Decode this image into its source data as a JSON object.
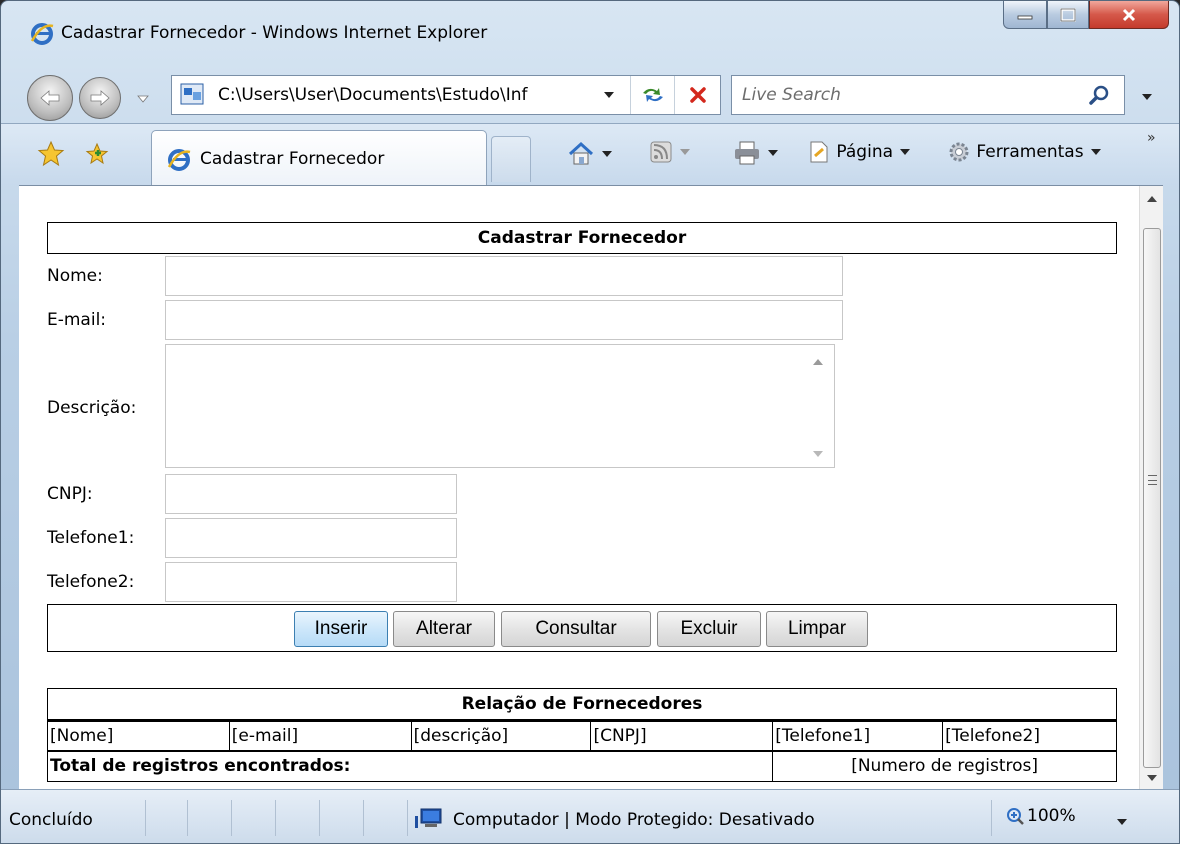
{
  "window": {
    "title": "Cadastrar Fornecedor - Windows Internet Explorer"
  },
  "address_bar": {
    "url": "C:\\Users\\User\\Documents\\Estudo\\Inf"
  },
  "search": {
    "placeholder": "Live Search"
  },
  "tab": {
    "label": "Cadastrar Fornecedor"
  },
  "command_bar": {
    "page_label": "Página",
    "tools_label": "Ferramentas"
  },
  "form": {
    "title": "Cadastrar Fornecedor",
    "labels": {
      "nome": "Nome:",
      "email": "E-mail:",
      "descricao": "Descrição:",
      "cnpj": "CNPJ:",
      "telefone1": "Telefone1:",
      "telefone2": "Telefone2:"
    },
    "values": {
      "nome": "",
      "email": "",
      "descricao": "",
      "cnpj": "",
      "telefone1": "",
      "telefone2": ""
    },
    "buttons": {
      "inserir": "Inserir",
      "alterar": "Alterar",
      "consultar": "Consultar",
      "excluir": "Excluir",
      "limpar": "Limpar"
    }
  },
  "listing": {
    "title": "Relação de Fornecedores",
    "columns": [
      "[Nome]",
      "[e-mail]",
      "[descrição]",
      "[CNPJ]",
      "[Telefone1]",
      "[Telefone2]"
    ],
    "total_label": "Total de registros encontrados:",
    "total_value": "[Numero de registros]"
  },
  "status_bar": {
    "status": "Concluído",
    "zone": "Computador | Modo Protegido: Desativado",
    "zoom": "100%"
  },
  "colors": {
    "ie_blue": "#2f6fc4",
    "close_red": "#c43b2c",
    "inserir_focus": "#3c7fb1"
  },
  "icons": {
    "title": "ie-logo-icon",
    "back": "back-arrow-icon",
    "forward": "forward-arrow-icon",
    "refresh": "refresh-icon",
    "stop": "stop-x-icon",
    "search": "magnifier-icon",
    "favorites": "favorites-star-icon",
    "add_favorite": "add-favorite-icon",
    "home": "home-icon",
    "feeds": "rss-feed-icon",
    "print": "printer-icon",
    "page": "page-icon",
    "tools": "gear-icon",
    "zone": "computer-icon",
    "zoom": "zoom-icon"
  }
}
